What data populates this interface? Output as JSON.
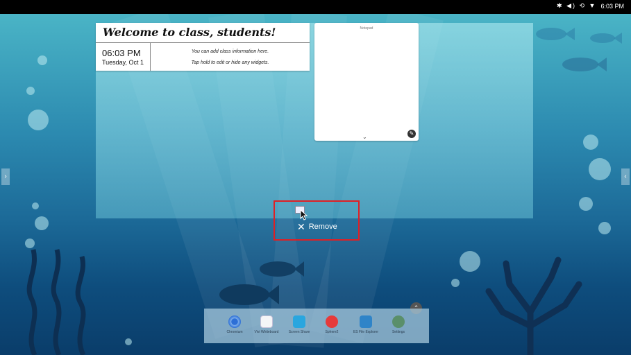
{
  "status_bar": {
    "time": "6:03 PM",
    "icons": "✱ ◀) ⟲ ▼"
  },
  "welcome_widget": {
    "title": "Welcome to class, students!",
    "time": "06:03 PM",
    "date": "Tuesday, Oct 1",
    "info_line1": "You can add class information here.",
    "info_line2": "Tap hold to edit or hide any widgets."
  },
  "notepad_widget": {
    "title": "Notepad"
  },
  "side_handles": {
    "left": "›",
    "right": "‹"
  },
  "remove_action": {
    "label": "Remove"
  },
  "dock": {
    "items": [
      {
        "label": "Chromium",
        "icon": "chromium-icon"
      },
      {
        "label": "Vivi Whiteboard",
        "icon": "whiteboard-icon"
      },
      {
        "label": "Screen Share",
        "icon": "screen-share-icon"
      },
      {
        "label": "Sphere2",
        "icon": "sphere2-icon"
      },
      {
        "label": "ES File Explorer",
        "icon": "file-explorer-icon"
      },
      {
        "label": "Settings",
        "icon": "settings-icon"
      }
    ]
  },
  "colors": {
    "highlight": "#e01f24",
    "status_bar": "#000000"
  }
}
